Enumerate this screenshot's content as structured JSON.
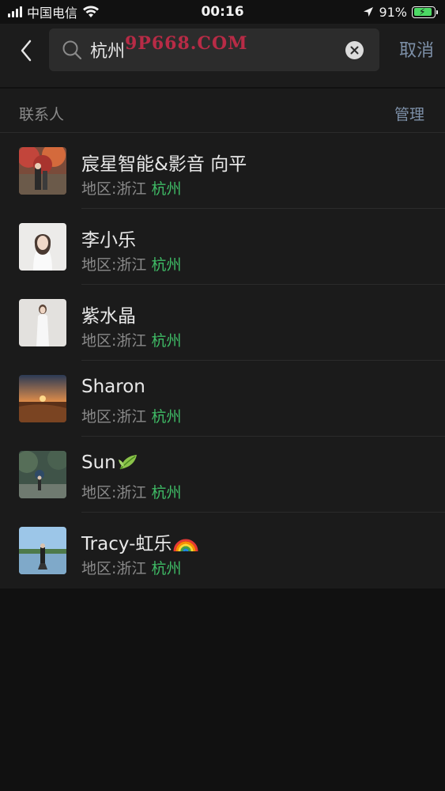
{
  "status_bar": {
    "carrier": "中国电信",
    "time": "00:16",
    "battery_percent": "91%",
    "battery_level": 0.91
  },
  "search": {
    "query": "杭州",
    "cancel_label": "取消",
    "watermark": "9P668.COM"
  },
  "section": {
    "title": "联系人",
    "manage_label": "管理"
  },
  "contacts": [
    {
      "name": "宸星智能&影音 向平",
      "region_prefix": "地区:浙江 ",
      "region_highlight": "杭州",
      "avatar": "photo-colorful-trees"
    },
    {
      "name": "李小乐",
      "region_prefix": "地区:浙江 ",
      "region_highlight": "杭州",
      "avatar": "photo-woman-white"
    },
    {
      "name": "紫水晶",
      "region_prefix": "地区:浙江 ",
      "region_highlight": "杭州",
      "avatar": "photo-woman-standing"
    },
    {
      "name": "Sharon",
      "region_prefix": "地区:浙江 ",
      "region_highlight": "杭州",
      "avatar": "photo-sunset"
    },
    {
      "name": "Sun",
      "region_prefix": "地区:浙江 ",
      "region_highlight": "杭州",
      "avatar": "photo-forest-figure",
      "emoji": "leaf-icon"
    },
    {
      "name": "Tracy-虹乐",
      "region_prefix": "地区:浙江 ",
      "region_highlight": "杭州",
      "avatar": "photo-lake",
      "emoji": "rainbow-icon"
    }
  ],
  "colors": {
    "background": "#111111",
    "panel": "#1b1b1b",
    "highlight": "#3fbc66",
    "link": "#7d90a8",
    "watermark": "#d12b4b"
  }
}
